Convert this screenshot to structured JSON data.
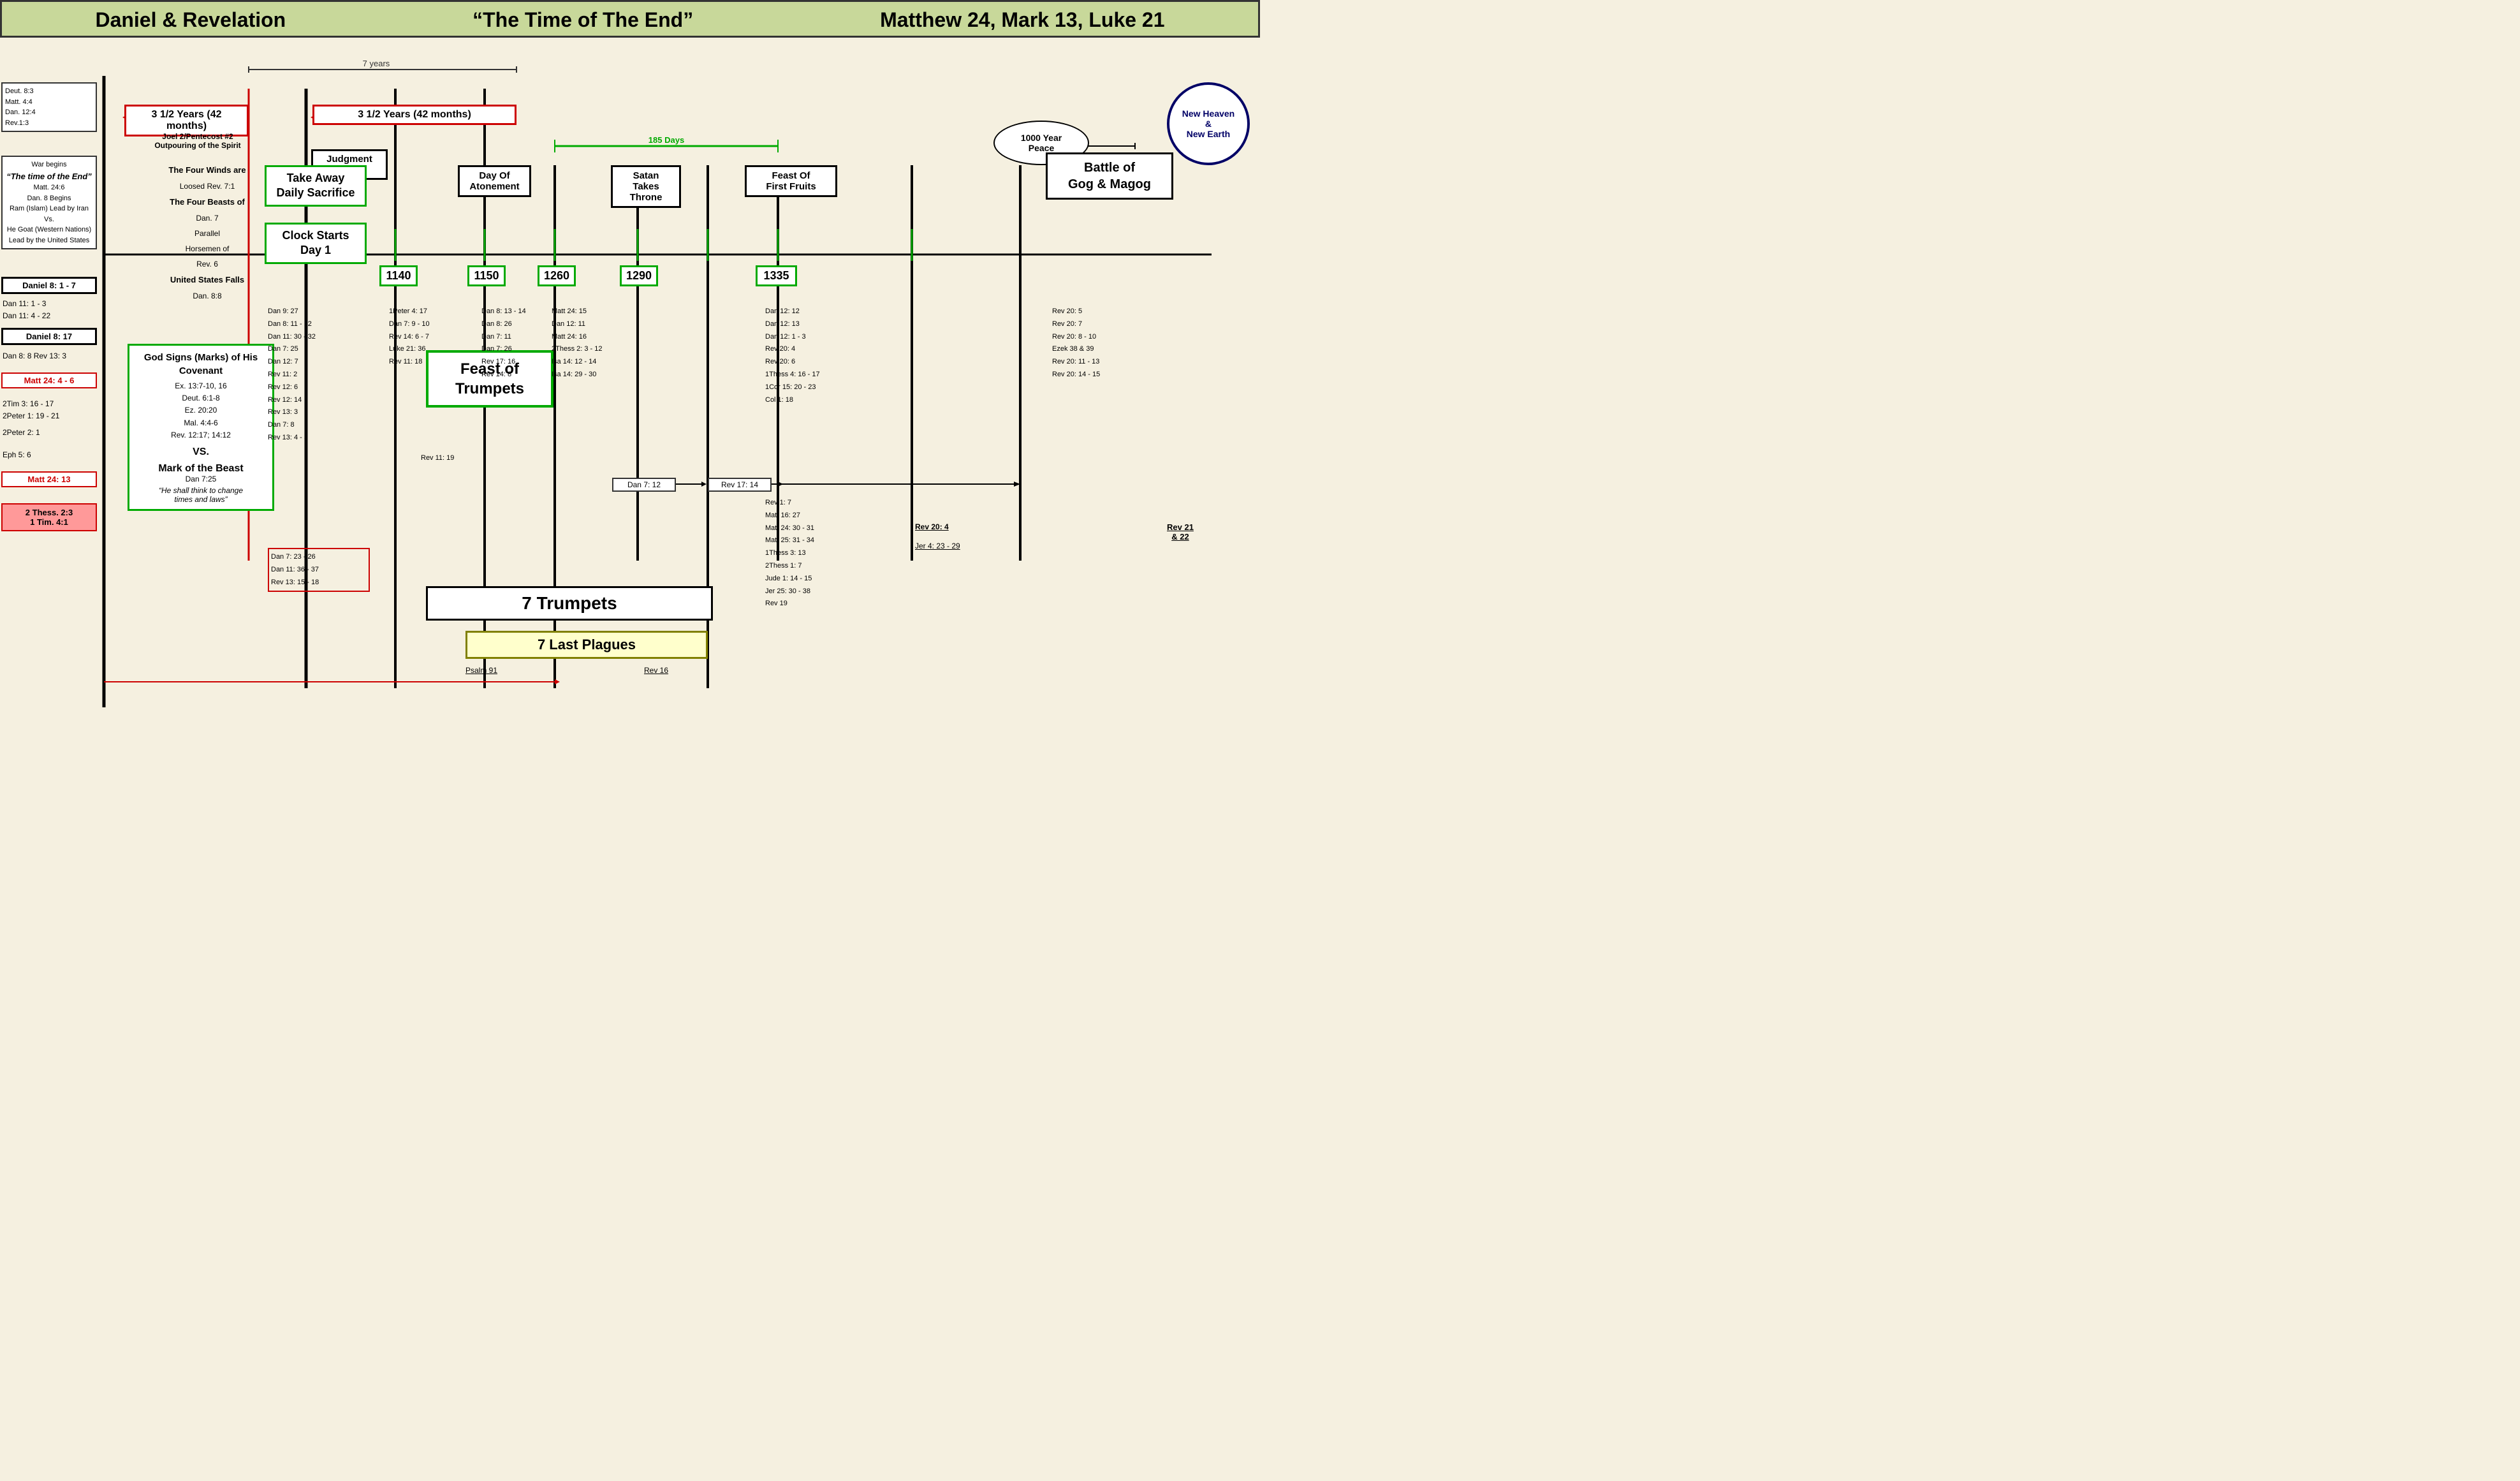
{
  "header": {
    "title1": "Daniel & Revelation",
    "title2": "“The Time of The End”",
    "title3": "Matthew 24, Mark 13, Luke 21"
  },
  "timeline": {
    "seven_years_label": "7 years",
    "period1_label": "3 1/2 Years  (42 months)",
    "period2_label": "3 1/2 Years  (42 months)",
    "joel_label": "Joel 2/Pentecost #2",
    "outpouring_label": "Outpouring of the Spirit",
    "judgment_label": "Judgment\nBegins",
    "days_185": "185 Days",
    "peace_label": "1000 Year\nPeace",
    "new_heaven_label": "New Heaven\n&\nNew Earth"
  },
  "left_col": {
    "refs1": "Deut. 8:3\nMatt. 4:4\nDan. 12:4\nRev.1:3",
    "war_begins": "War begins",
    "time_end": "“The time of the End”",
    "refs2": "Matt. 24:6\nDan. 8 Begins\nRam (Islam) Lead by Iran\nVs.\nHe Goat (Western Nations) Lead by the United States",
    "daniel_8_1_7": "Daniel 8: 1 - 7",
    "dan_11_1_3": "Dan 11: 1 - 3",
    "dan_11_4_22": "Dan 11: 4 - 22",
    "daniel_8_17": "Daniel 8: 17",
    "dan8_rev13": "Dan 8: 8  Rev 13: 3",
    "matt_24_4_6": "Matt 24: 4 - 6",
    "tim_peter": "2Tim  3: 16 - 17\n2Peter  1: 19 - 21",
    "peter2": "2Peter  2: 1",
    "eph": "Eph  5: 6",
    "matt_24_13": "Matt 24: 13",
    "thess_tim": "2 Thess. 2:3\n1 Tim. 4:1"
  },
  "center_events": {
    "take_away": "Take Away\nDaily Sacrifice",
    "clock_starts": "Clock Starts\nDay 1",
    "num_1140": "1140",
    "day_atonement": "Day Of\nAtonement",
    "num_1150": "1150",
    "num_1260": "1260",
    "feast_trumpets": "Feast of\nTrumpets",
    "satan_throne": "Satan\nTakes\nThrone",
    "num_1290": "1290",
    "feast_first": "Feast Of\nFirst Fruits",
    "num_1335": "1335",
    "trumpets_7": "7 Trumpets",
    "plagues_7": "7 Last Plagues",
    "psalm_91": "Psalm 91",
    "rev_16": "Rev 16",
    "battle_gog": "Battle of\nGog & Magog",
    "rev_20_4": "Rev 20: 4",
    "jer_4": "Jer 4: 23 - 29",
    "rev_21": "Rev 21\n& 22"
  },
  "four_winds": {
    "line1": "The Four Winds are",
    "line2": "Loosed Rev. 7:1",
    "line3": "The Four Beasts of",
    "line4": "Dan. 7",
    "line5": "Parallel",
    "line6": "Horsemen of",
    "line7": "Rev. 6",
    "line8": "United States Falls",
    "line9": "Dan. 8:8"
  },
  "god_signs": {
    "title": "God Signs (Marks)\nof His Covenant",
    "refs": "Ex. 13:7-10, 16\nDeut. 6:1-8\nEz. 20:20\nMal. 4:4-6\nRev. 12:17; 14:12",
    "vs": "VS.",
    "beast_title": "Mark of the Beast",
    "beast_ref": "Dan 7:25",
    "beast_text": "“He shall think to change\ntimes and laws”"
  },
  "references": {
    "col1": [
      "Dan 9: 27",
      "Dan  8: 11 - 12",
      "Dan 11: 30 - 32",
      "Dan  7: 25",
      "Dan 12: 7",
      "Rev 11: 2",
      "Rev 12: 6",
      "Rev 12: 14",
      "Rev 13: 3",
      "Dan  7: 8",
      "Rev 13: 4 - 5"
    ],
    "col1_red": [
      "Dan  7: 23 - 26",
      "Dan 11: 36 - 37",
      "Rev 13: 15 - 18"
    ],
    "col2": [
      "1Peter  4: 17",
      "Dan 7: 9 - 10",
      "Rev 14: 6 - 7",
      "Luke  21: 36",
      "Rev 11: 18"
    ],
    "col2b": [
      "Rev 11: 19"
    ],
    "col3": [
      "Dan 8: 13 - 14",
      "Dan 8: 26",
      "Dan 7: 11",
      "Dan 7: 26",
      "Rev 17: 16",
      "Rev 14: 8"
    ],
    "col4": [
      "Matt 24: 15",
      "Dan 12: 11",
      "Matt 24: 16",
      "2Thess 2: 3 - 12",
      "Isa  14: 12 - 14",
      "Isa  14: 29 - 30"
    ],
    "col5": [
      "Dan 12: 12",
      "Dan 12: 13",
      "Dan 12: 1 - 3",
      "Rev 20: 4",
      "Rev 20: 6",
      "1Thess  4: 16 - 17",
      "1Cor  15: 20 - 23",
      "Col  1: 18"
    ],
    "col5b": [
      "Rev 1: 7",
      "Matt 16: 27",
      "Matt 24: 30 - 31",
      "Matt 25: 31 - 34",
      "1Thess 3: 13",
      "2Thess 1: 7",
      "Jude 1: 14 - 15",
      "Jer 25: 30 - 38",
      "Rev 19"
    ],
    "col6": [
      "Rev 20: 5",
      "Rev 20: 7",
      "Rev 20: 8 - 10",
      "Ezek 38 & 39",
      "Rev 20: 11 - 13",
      "Rev 20: 14 - 15"
    ],
    "dan7_12": "Dan  7: 12",
    "rev17_14": "Rev  17: 14"
  }
}
